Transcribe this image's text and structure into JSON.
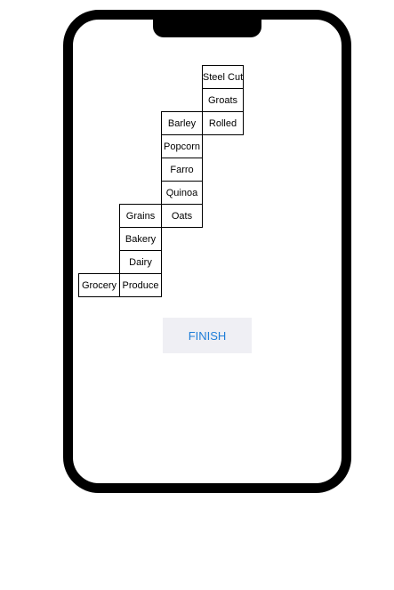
{
  "tree": {
    "level1": [
      "Grocery"
    ],
    "level2": [
      "Produce",
      "Dairy",
      "Bakery",
      "Grains"
    ],
    "level3": [
      "Oats",
      "Quinoa",
      "Farro",
      "Popcorn",
      "Barley"
    ],
    "level4": [
      "Rolled",
      "Groats",
      "Steel Cut"
    ]
  },
  "actions": {
    "finish_label": "FINISH"
  }
}
